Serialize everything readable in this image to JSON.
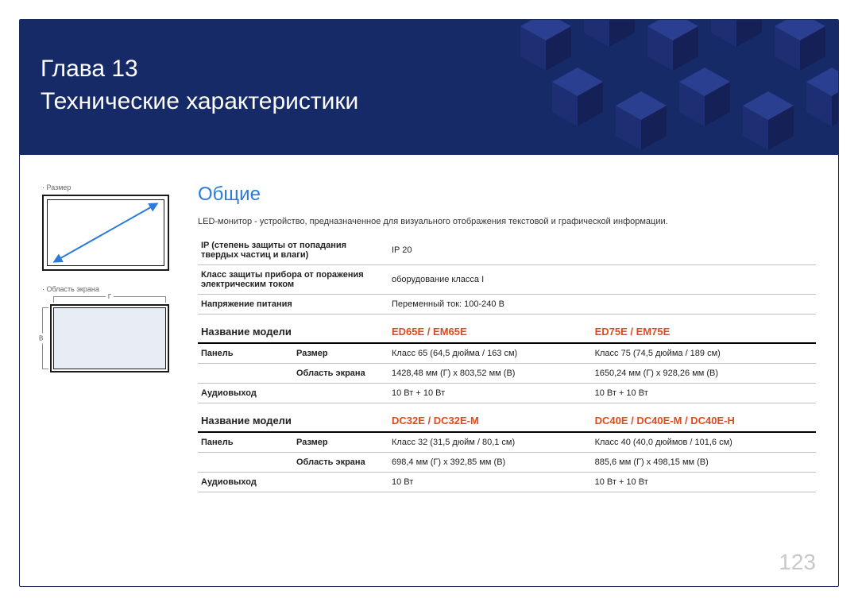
{
  "banner": {
    "chapter": "Глава 13",
    "title": "Технические характеристики"
  },
  "sidebar": {
    "size_label": "Размер",
    "area_label": "Область экрана",
    "width_letter": "Г",
    "height_letter": "В"
  },
  "main": {
    "heading": "Общие",
    "intro": "LED-монитор - устройство, предназначенное для визуального отображения текстовой и графической информации.",
    "general_rows": [
      {
        "label": "IP (степень защиты от попадания твердых частиц и влаги)",
        "value": "IP 20"
      },
      {
        "label": "Класс защиты прибора от поражения электрическим током",
        "value": "оборудование класса I"
      },
      {
        "label": "Напряжение питания",
        "value": "Переменный ток: 100-240 В"
      }
    ],
    "model_label": "Название модели",
    "panel_label": "Панель",
    "size_row": "Размер",
    "area_row": "Область экрана",
    "audio_row": "Аудиовыход",
    "blocks": [
      {
        "models": [
          "ED65E / EM65E",
          "ED75E / EM75E"
        ],
        "size": [
          "Класс 65 (64,5 дюйма / 163 см)",
          "Класс 75 (74,5 дюйма / 189 см)"
        ],
        "area": [
          "1428,48 мм (Г) x 803,52 мм (В)",
          "1650,24 мм (Г) x 928,26 мм (В)"
        ],
        "audio": [
          "10 Вт + 10 Вт",
          "10 Вт + 10 Вт"
        ]
      },
      {
        "models": [
          "DC32E / DC32E-M",
          "DC40E / DC40E-M / DC40E-H"
        ],
        "size": [
          "Класс 32 (31,5 дюйм / 80,1 см)",
          "Класс 40 (40,0 дюймов / 101,6 см)"
        ],
        "area": [
          "698,4 мм (Г) x 392,85 мм (В)",
          "885,6 мм (Г) x 498,15 мм (В)"
        ],
        "audio": [
          "10 Вт",
          "10 Вт + 10 Вт"
        ]
      }
    ]
  },
  "page_number": "123"
}
